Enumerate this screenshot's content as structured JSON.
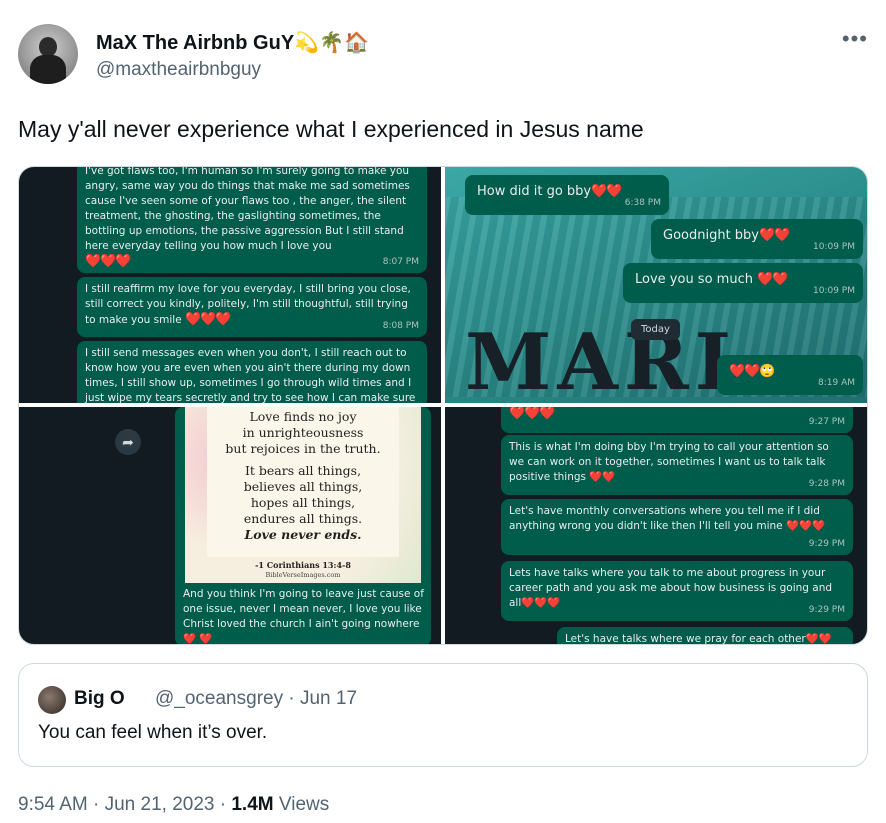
{
  "author": {
    "display_name": "MaX The Airbnb GuY💫🌴🏠",
    "handle": "@maxtheairbnbguy"
  },
  "more_label": "•••",
  "tweet": {
    "text": "May y'all never experience what I experienced in Jesus name"
  },
  "media": {
    "panel1": {
      "msg1": "I've got flaws too, I'm human so I'm surely going to make you angry, same way you do things that make me sad sometimes cause I've seen some of your flaws too , the anger, the silent treatment, the ghosting, the gaslighting sometimes, the bottling up emotions, the passive aggression But I still stand here everyday telling you how much I love you",
      "msg1_hearts": "❤️❤️❤️",
      "msg1_time": "8:07 PM",
      "msg2": "I still reaffirm my love for you everyday, I still bring you close, still correct you kindly, politely, I'm still thoughtful, still trying to make you smile",
      "msg2_hearts": "❤️❤️❤️",
      "msg2_time": "8:08 PM",
      "msg3": "I still send messages even when you don't, I still reach out to know how you are even when you ain't there during my down times, I still show up, sometimes I go through wild times and I just wipe my tears secretly and try to see how I can make sure"
    },
    "panel2": {
      "msg1": "How did it go bby",
      "msg1_hearts": "❤️❤️",
      "msg1_time": "6:38 PM",
      "msg2": "Goodnight bby",
      "msg2_hearts": "❤️❤️",
      "msg2_time": "10:09 PM",
      "msg3": "Love you so much",
      "msg3_hearts": "❤️❤️",
      "msg3_time": "10:09 PM",
      "today": "Today",
      "msg4": "❤️❤️🙄",
      "msg4_time": "8:19 AM",
      "shirt_text": "MARL"
    },
    "panel3": {
      "verse_lines": [
        "Love finds no joy",
        "in unrighteousness",
        "but rejoices in the truth.",
        "It bears all things,",
        "believes all things,",
        "hopes all things,",
        "endures all things."
      ],
      "verse_last": "Love never ends.",
      "citation": "-1 Corinthians 13:4-8",
      "site": "BibleVerseImages.com",
      "caption": "And you think I'm going to leave just cause of one issue, never I mean never, I love you like Christ loved the church I ain't going nowhere ❤️ ❤️"
    },
    "panel4": {
      "top_hearts": "❤️❤️❤️",
      "top_time": "9:27 PM",
      "msg1": "This is what I'm doing bby I'm trying to call your attention so we can work on it together, sometimes I want us to talk talk positive things ❤️❤️",
      "msg1_time": "9:28 PM",
      "msg2": "Let's have monthly conversations where you tell me if I did anything wrong you didn't like then I'll tell you mine ❤️❤️❤️",
      "msg2_time": "9:29 PM",
      "msg3": "Lets have talks where you talk to me about progress in your career path and you ask me about how business is going and all❤️❤️❤️",
      "msg3_time": "9:29 PM",
      "msg4": "Let's have talks where we pray for each other❤️❤️"
    }
  },
  "quote": {
    "name": "Big O",
    "meta": "@_oceansgrey · Jun 17",
    "text": "You can feel when it’s over."
  },
  "footer": {
    "time_date": "9:54 AM · Jun 21, 2023 · ",
    "views_count": "1.4M",
    "views_label": " Views"
  }
}
